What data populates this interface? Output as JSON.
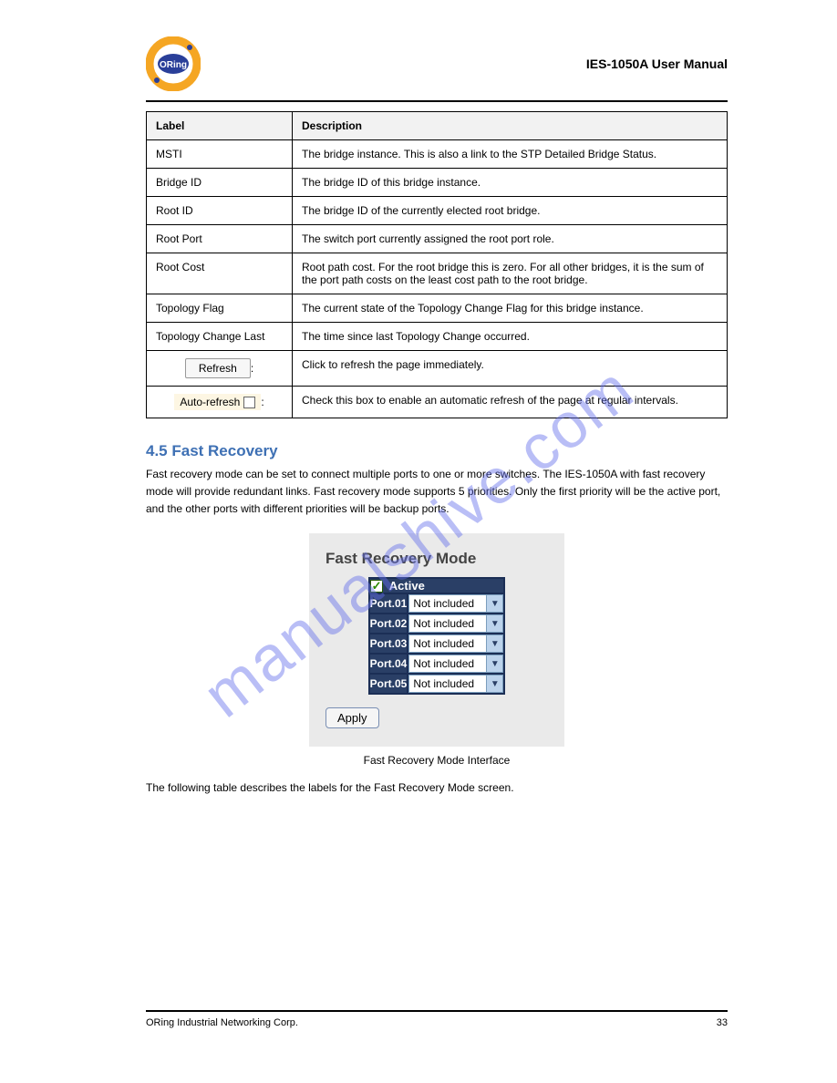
{
  "header": {
    "title": "IES-1050A User Manual"
  },
  "paramsTable": {
    "headers": [
      "Label",
      "Description"
    ],
    "rows": [
      {
        "label": "MSTI",
        "desc": "The bridge instance. This is also a link to the STP Detailed Bridge Status."
      },
      {
        "label": "Bridge ID",
        "desc": "The bridge ID of this bridge instance."
      },
      {
        "label": "Root ID",
        "desc": "The bridge ID of the currently elected root bridge."
      },
      {
        "label": "Root Port",
        "desc": "The switch port currently assigned the root port role."
      },
      {
        "label": "Root Cost",
        "desc": "Root path cost. For the root bridge this is zero. For all other bridges, it is the sum of the port path costs on the least cost path to the root bridge."
      },
      {
        "label": "Topology Flag",
        "desc": "The current state of the Topology Change Flag for this bridge instance."
      },
      {
        "label": "Topology Change Last",
        "desc": "The time since last Topology Change occurred."
      },
      {
        "label_btn": "Refresh",
        "suffix": ":",
        "desc": "Click to refresh the page immediately."
      },
      {
        "label_chk": "Auto-refresh",
        "suffix": ":",
        "desc": "Check this box to enable an automatic refresh of the page at regular intervals."
      }
    ]
  },
  "section": {
    "title": "4.5 Fast Recovery",
    "body": "Fast recovery mode can be set to connect multiple ports to one or more switches. The IES-1050A with fast recovery mode will provide redundant links. Fast recovery mode supports 5 priorities. Only the first priority will be the active port, and the other ports with different priorities will be backup ports.",
    "caption": "Fast Recovery Mode Interface",
    "note": "The following table describes the labels for the Fast Recovery Mode screen."
  },
  "fastRecovery": {
    "panelTitle": "Fast Recovery Mode",
    "activeLabel": "Active",
    "ports": [
      {
        "name": "Port.01",
        "value": "Not included"
      },
      {
        "name": "Port.02",
        "value": "Not included"
      },
      {
        "name": "Port.03",
        "value": "Not included"
      },
      {
        "name": "Port.04",
        "value": "Not included"
      },
      {
        "name": "Port.05",
        "value": "Not included"
      }
    ],
    "applyLabel": "Apply"
  },
  "footer": {
    "left": "ORing Industrial Networking Corp.",
    "right": "33"
  },
  "watermark": "manualshive.com"
}
